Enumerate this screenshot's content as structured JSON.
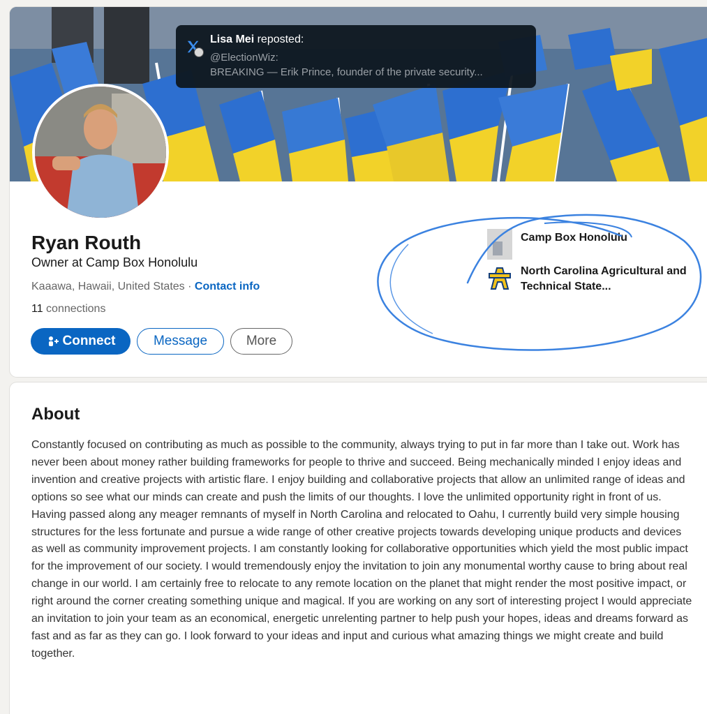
{
  "tooltip": {
    "reposter_name": "Lisa Mei",
    "reposted_label": " reposted:",
    "handle": "@ElectionWiz:",
    "preview": "BREAKING — Erik Prince, founder of the private security..."
  },
  "profile": {
    "name": "Ryan Routh",
    "headline": "Owner at Camp Box Honolulu",
    "location": "Kaaawa, Hawaii, United States",
    "separator": " · ",
    "contact_info": "Contact info",
    "connections_count": "11",
    "connections_label": " connections"
  },
  "actions": {
    "connect": "Connect",
    "message": "Message",
    "more": "More"
  },
  "organizations": [
    {
      "name": "Camp Box Honolulu",
      "icon": "company-logo-icon"
    },
    {
      "name": "North Carolina Agricultural and Technical State...",
      "icon": "university-logo-icon"
    }
  ],
  "about": {
    "title": "About",
    "paragraphs": [
      "Constantly focused on contributing as much as possible to the community, always trying to put in far more than I take out. Work has never been about money rather building frameworks for people to thrive and succeed. Being mechanically minded I enjoy ideas and invention and creative projects with artistic flare. I enjoy building and collaborative projects that allow an unlimited range of ideas and options so see what our minds can create and push the limits of our thoughts. I love the unlimited opportunity right in front of us.",
      "Having passed along any meager remnants of myself in North Carolina and relocated to Oahu, I currently build very simple housing structures for the less fortunate and pursue a wide range of other creative projects towards developing unique products and devices as well as community improvement projects. I am constantly looking for collaborative opportunities which yield the most public impact for the improvement of our society. I would tremendously enjoy the invitation to join any monumental worthy cause to bring about real change in our world. I am certainly free to relocate to any remote location on the planet that might render the most positive impact, or right around the corner creating something unique and magical. If you are working on any sort of interesting project I would appreciate an invitation to join your team as an economical, energetic unrelenting partner to help push your hopes, ideas and dreams forward as fast and as far as they can go. I look forward to your ideas and input and curious what amazing things we might create and build together."
    ]
  },
  "colors": {
    "accent": "#0a66c2",
    "ink_annotation": "#3b82e0",
    "flag_blue": "#2d6fd0",
    "flag_yellow": "#f2d229"
  }
}
